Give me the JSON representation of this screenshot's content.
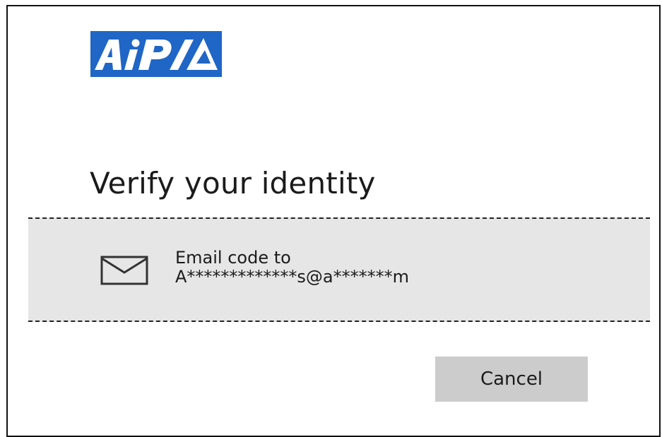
{
  "logo": {
    "text": "AiPSA",
    "background": "#1f66c6",
    "foreground": "#ffffff"
  },
  "title": "Verify your identity",
  "option": {
    "icon": "envelope-icon",
    "line1": "Email code to",
    "line2": "A*************s@a*******m",
    "background": "#e6e6e6"
  },
  "cancel_label": "Cancel"
}
